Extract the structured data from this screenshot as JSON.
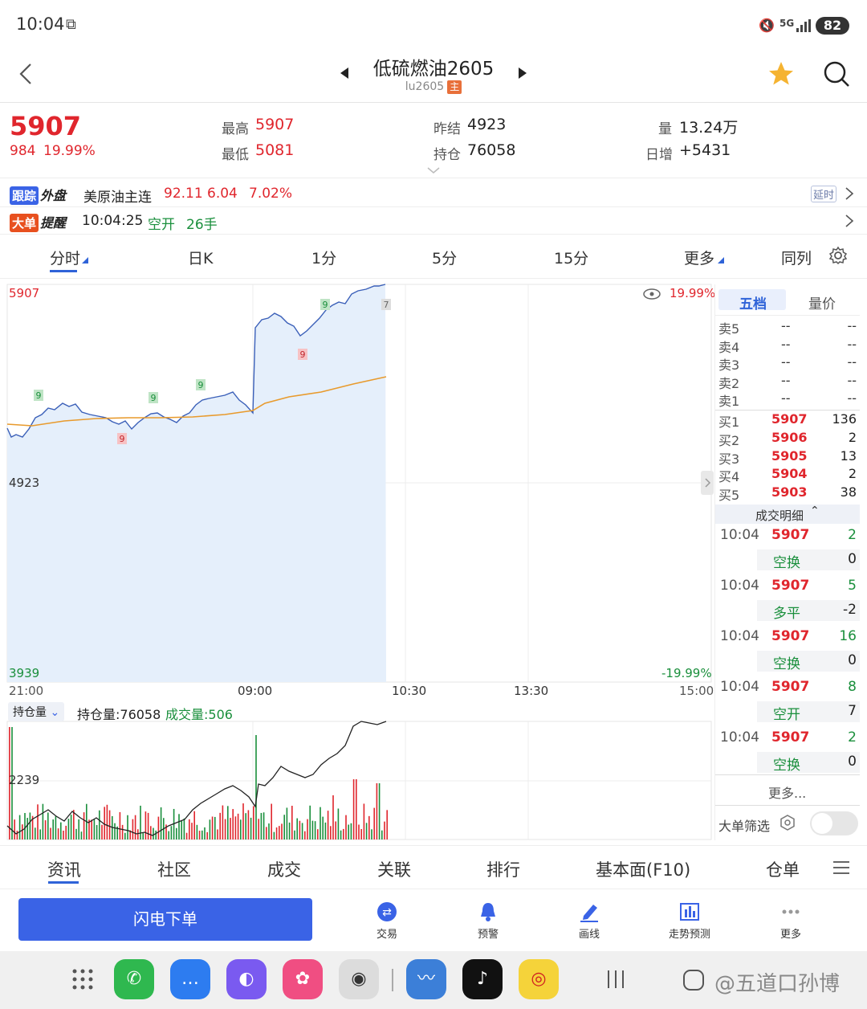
{
  "status_bar": {
    "time": "10:04",
    "network": "5G",
    "battery": "82"
  },
  "header": {
    "title": "低硫燃油2605",
    "code": "lu2605",
    "main_tag": "主"
  },
  "quote": {
    "price": "5907",
    "change": "984",
    "change_pct": "19.99%",
    "high_label": "最高",
    "high": "5907",
    "low_label": "最低",
    "low": "5081",
    "prev_settle_label": "昨结",
    "prev_settle": "4923",
    "oi_label": "持仓",
    "oi": "76058",
    "vol_label": "量",
    "vol": "13.24万",
    "daily_inc_label": "日增",
    "daily_inc": "+5431"
  },
  "track": {
    "tag1": "跟踪",
    "tag2": "外盘",
    "name": "美原油主连",
    "price": "92.11",
    "chg": "6.04",
    "pct": "7.02%",
    "delay": "延时"
  },
  "alert": {
    "tag1": "大单",
    "tag2": "提醒",
    "time": "10:04:25",
    "action": "空开",
    "qty": "26手"
  },
  "tabs": [
    "分时",
    "日K",
    "1分",
    "5分",
    "15分",
    "更多",
    "同列"
  ],
  "chart": {
    "top_price": "5907",
    "mid_price": "4923",
    "bot_price": "3939",
    "top_pct": "19.99%",
    "bot_pct": "-19.99%",
    "x_labels": [
      "21:00",
      "09:00",
      "10:30",
      "13:30",
      "15:00"
    ],
    "markers": [
      "9",
      "9",
      "9",
      "9",
      "9",
      "9",
      "7"
    ],
    "sub_selector": "持仓量",
    "sub_oi": "持仓量:76058",
    "sub_vol": "成交量:506",
    "sub_axis": "2239"
  },
  "book": {
    "tab_active": "五档",
    "tab_other": "量价",
    "asks": [
      {
        "label": "卖5",
        "price": "--",
        "qty": "--"
      },
      {
        "label": "卖4",
        "price": "--",
        "qty": "--"
      },
      {
        "label": "卖3",
        "price": "--",
        "qty": "--"
      },
      {
        "label": "卖2",
        "price": "--",
        "qty": "--"
      },
      {
        "label": "卖1",
        "price": "--",
        "qty": "--"
      }
    ],
    "bids": [
      {
        "label": "买1",
        "price": "5907",
        "qty": "136"
      },
      {
        "label": "买2",
        "price": "5906",
        "qty": "2"
      },
      {
        "label": "买3",
        "price": "5905",
        "qty": "13"
      },
      {
        "label": "买4",
        "price": "5904",
        "qty": "2"
      },
      {
        "label": "买5",
        "price": "5903",
        "qty": "38"
      }
    ],
    "detail_header": "成交明细",
    "trades": [
      {
        "time": "10:04",
        "price": "5907",
        "qty": "2",
        "type": "空换",
        "oi": "0"
      },
      {
        "time": "10:04",
        "price": "5907",
        "qty": "5",
        "type": "多平",
        "oi": "-2"
      },
      {
        "time": "10:04",
        "price": "5907",
        "qty": "16",
        "type": "空换",
        "oi": "0"
      },
      {
        "time": "10:04",
        "price": "5907",
        "qty": "8",
        "type": "空开",
        "oi": "7"
      },
      {
        "time": "10:04",
        "price": "5907",
        "qty": "2",
        "type": "空换",
        "oi": "0"
      }
    ],
    "more": "更多...",
    "filter": "大单筛选"
  },
  "bottom_tabs": [
    "资讯",
    "社区",
    "成交",
    "关联",
    "排行",
    "基本面(F10)",
    "仓单"
  ],
  "actions": {
    "flash_order": "闪电下单",
    "items": [
      "交易",
      "预警",
      "画线",
      "走势预测",
      "更多"
    ]
  },
  "watermark": "@五道口孙博"
}
